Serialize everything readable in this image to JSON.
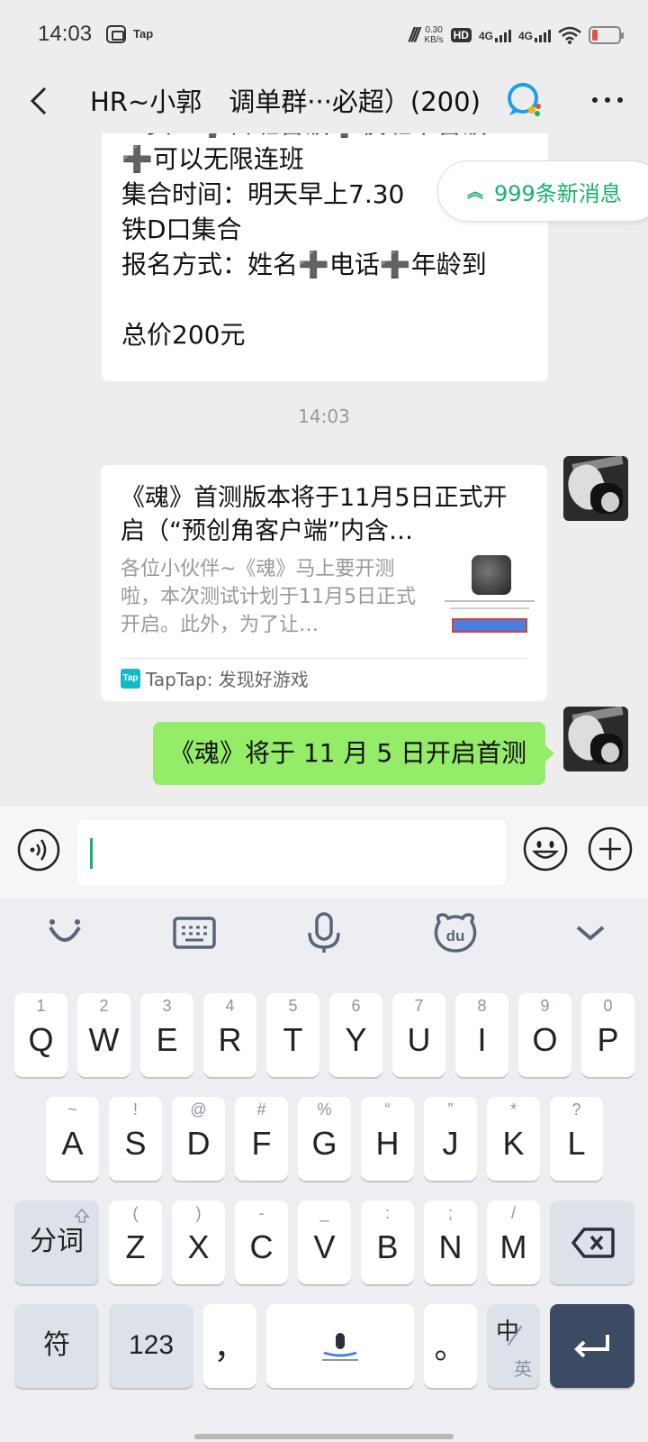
{
  "status_bar": {
    "time": "14:03",
    "app_tag": "Tap",
    "speed_value": "0.30",
    "speed_unit": "KB/s",
    "hd_label": "HD",
    "net1": "4G",
    "net2": "4G",
    "icons": [
      "nfc-icon",
      "hd-icon",
      "signal-icon",
      "wifi-icon",
      "battery-icon"
    ],
    "battery_color": "#e64d3d"
  },
  "header": {
    "title_part1": "HR~小郭",
    "title_part2": "调单群···必超）(200)",
    "icons": [
      "back-arrow-icon",
      "chat-bubble-icon",
      "more-icon"
    ]
  },
  "chat": {
    "top_message_lines": [
      "工资：➕日班管饭➕夜班不管饭",
      "➕可以无限连班",
      "集合时间：明天早上7.30",
      "铁D口集合",
      "报名方式：姓名➕电话➕年龄到",
      "",
      "总价200元"
    ],
    "new_messages": "999条新消息",
    "timestamp": "14:03",
    "card": {
      "title": "《魂》首测版本将于11月5日正式开启（“预创角客户端”内含…",
      "description": "各位小伙伴~《魂》马上要开测啦，本次测试计划于11月5日正式开启。此外，为了让…",
      "source": "TapTap: 发现好游戏",
      "source_badge": "Tap"
    },
    "sent_message": "《魂》将于 11 月 5 日开启首测"
  },
  "input_bar": {
    "value": "",
    "icons": [
      "voice-icon",
      "emoji-icon",
      "plus-icon"
    ],
    "caret_color": "#19b06e"
  },
  "keyboard": {
    "toolbar_icons": [
      "smile-icon",
      "keyboard-icon",
      "microphone-icon",
      "du-bear-icon",
      "collapse-chevron-icon"
    ],
    "row1": [
      {
        "hint": "1",
        "key": "Q"
      },
      {
        "hint": "2",
        "key": "W"
      },
      {
        "hint": "3",
        "key": "E"
      },
      {
        "hint": "4",
        "key": "R"
      },
      {
        "hint": "5",
        "key": "T"
      },
      {
        "hint": "6",
        "key": "Y"
      },
      {
        "hint": "7",
        "key": "U"
      },
      {
        "hint": "8",
        "key": "I"
      },
      {
        "hint": "9",
        "key": "O"
      },
      {
        "hint": "0",
        "key": "P"
      }
    ],
    "row2": [
      {
        "hint": "~",
        "key": "A"
      },
      {
        "hint": "!",
        "key": "S"
      },
      {
        "hint": "@",
        "key": "D"
      },
      {
        "hint": "#",
        "key": "F"
      },
      {
        "hint": "%",
        "key": "G"
      },
      {
        "hint": "“",
        "key": "H"
      },
      {
        "hint": "”",
        "key": "J"
      },
      {
        "hint": "*",
        "key": "K"
      },
      {
        "hint": "?",
        "key": "L"
      }
    ],
    "row3": [
      {
        "hint": "(",
        "key": "Z"
      },
      {
        "hint": ")",
        "key": "X"
      },
      {
        "hint": "-",
        "key": "C"
      },
      {
        "hint": "_",
        "key": "V"
      },
      {
        "hint": ":",
        "key": "B"
      },
      {
        "hint": ";",
        "key": "N"
      },
      {
        "hint": "/",
        "key": "M"
      }
    ],
    "shift_label": "分词",
    "symbols_label": "符",
    "numbers_label": "123",
    "comma_label": "，",
    "period_label": "。",
    "lang_primary": "中",
    "lang_secondary": "英",
    "enter_color": "#3c4a63"
  }
}
